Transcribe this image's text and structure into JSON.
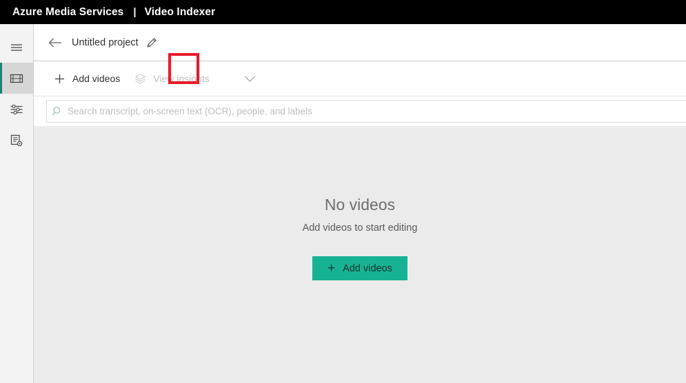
{
  "topbar": {
    "brand": "Azure Media Services",
    "separator": "|",
    "section": "Video Indexer"
  },
  "sidebar": {
    "items": [
      {
        "name": "menu",
        "icon": "hamburger-menu-icon",
        "selected": false
      },
      {
        "name": "media",
        "icon": "film-strip-icon",
        "selected": true
      },
      {
        "name": "settings",
        "icon": "sliders-icon",
        "selected": false
      },
      {
        "name": "model-customization",
        "icon": "document-gear-icon",
        "selected": false
      }
    ]
  },
  "header": {
    "back_icon": "arrow-left-icon",
    "project_title": "Untitled project",
    "edit_icon": "pencil-icon",
    "annotation": {
      "shape": "rectangle",
      "color": "#e8192c",
      "target": "edit-project-name-button"
    }
  },
  "toolbar": {
    "add_videos_label": "Add videos",
    "add_videos_icon": "plus-icon",
    "view_insights_label": "View insights",
    "view_insights_icon": "layers-icon",
    "view_insights_disabled": true,
    "caret_icon": "chevron-down-icon"
  },
  "search": {
    "icon": "search-icon",
    "value": "",
    "placeholder": "Search transcript, on-screen text (OCR), people, and labels"
  },
  "empty_state": {
    "title": "No videos",
    "subtitle": "Add videos to start editing",
    "button_label": "Add videos",
    "button_icon": "plus-icon",
    "button_color": "#17b294"
  },
  "colors": {
    "brand_bar": "#000000",
    "accent_teal": "#17b294",
    "selected_rail_bar": "#0f8a72",
    "stage_background": "#ebebeb",
    "annotation_red": "#e8192c"
  }
}
